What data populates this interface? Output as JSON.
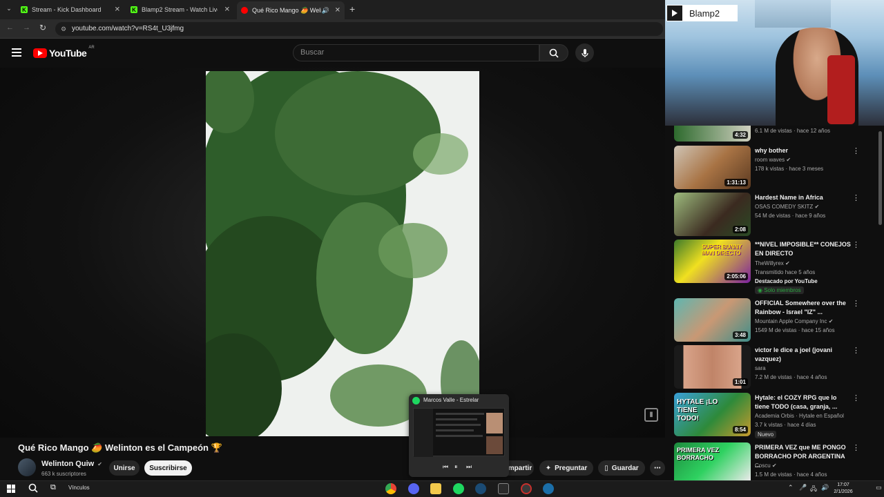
{
  "browser": {
    "tabs": [
      {
        "title": "Stream - Kick Dashboard",
        "icon": "kick-icon"
      },
      {
        "title": "Blamp2 Stream - Watch Live on",
        "icon": "kick-icon"
      },
      {
        "title": "Qué Rico Mango 🥭 Welin",
        "icon": "youtube-icon"
      }
    ],
    "new_tab": "+",
    "url": "youtube.com/watch?v=RS4t_U3jfmg"
  },
  "youtube": {
    "logo_text": "YouTube",
    "region": "AR",
    "search_placeholder": "Buscar"
  },
  "video": {
    "title": "Qué Rico Mango 🥭 Welinton es el Campeón 🏆",
    "channel": "Welinton Quiw",
    "subscribers": "663 k suscriptores",
    "join_label": "Unirse",
    "subscribe_label": "Suscribirse",
    "share_label": "mpartir",
    "ask_label": "Preguntar",
    "save_label": "Guardar"
  },
  "webcam": {
    "channel_label": "Blamp2"
  },
  "recommendations": [
    {
      "title": "",
      "channel": "",
      "meta": "6.1 M de vistas · hace 12 años",
      "duration": "4:32"
    },
    {
      "title": "why bother",
      "channel": "room waves",
      "meta": "178 k vistas · hace 3 meses",
      "duration": "1:31:13"
    },
    {
      "title": "Hardest Name in Africa",
      "channel": "OSAS COMEDY SKITZ",
      "meta": "54 M de vistas · hace 9 años",
      "duration": "2:08"
    },
    {
      "title": "**NIVEL IMPOSIBLE** CONEJOS EN DIRECTO",
      "channel": "TheWillyrex",
      "meta": "Transmitido hace 5 años",
      "extra": "Destacado por YouTube",
      "badge": "Solo miembros",
      "duration": "2:05:06"
    },
    {
      "title": "OFFICIAL Somewhere over the Rainbow - Israel \"IZ\" ...",
      "channel": "Mountain Apple Company Inc",
      "meta": "1549 M de vistas · hace 15 años",
      "duration": "3:48"
    },
    {
      "title": "victor le dice a joel (jovani vazquez)",
      "channel": "sara",
      "meta": "7.2 M de vistas · hace 4 años",
      "duration": "1:01"
    },
    {
      "title": "Hytale: el COZY RPG que lo tiene TODO (casa, granja, ...",
      "channel": "Academia Orbis · Hytale en Español",
      "meta": "3.7 k vistas · hace 4 días",
      "badge": "Nuevo",
      "duration": "8:54"
    },
    {
      "title": "PRIMERA VEZ que ME PONGO BORRACHO POR ARGENTINA ...",
      "channel": "Coscu",
      "meta": "1.5 M de vistas · hace 4 años",
      "duration": ""
    }
  ],
  "thumb_text": {
    "bunny": "SUPER BUNNY MAN DIRECTO",
    "hytale": "HYTALE ¡LO TIENE TODO!",
    "borracho": "PRIMERA VEZ BORRACHO"
  },
  "spotify": {
    "now_playing": "Marcos Valle - Estrelar"
  },
  "taskbar": {
    "links_label": "Vínculos",
    "time": "17:07",
    "date": "2/1/2026"
  },
  "colors": {
    "yt_red": "#ff0000",
    "kick_green": "#53fc18",
    "spotify_green": "#1ed760"
  }
}
